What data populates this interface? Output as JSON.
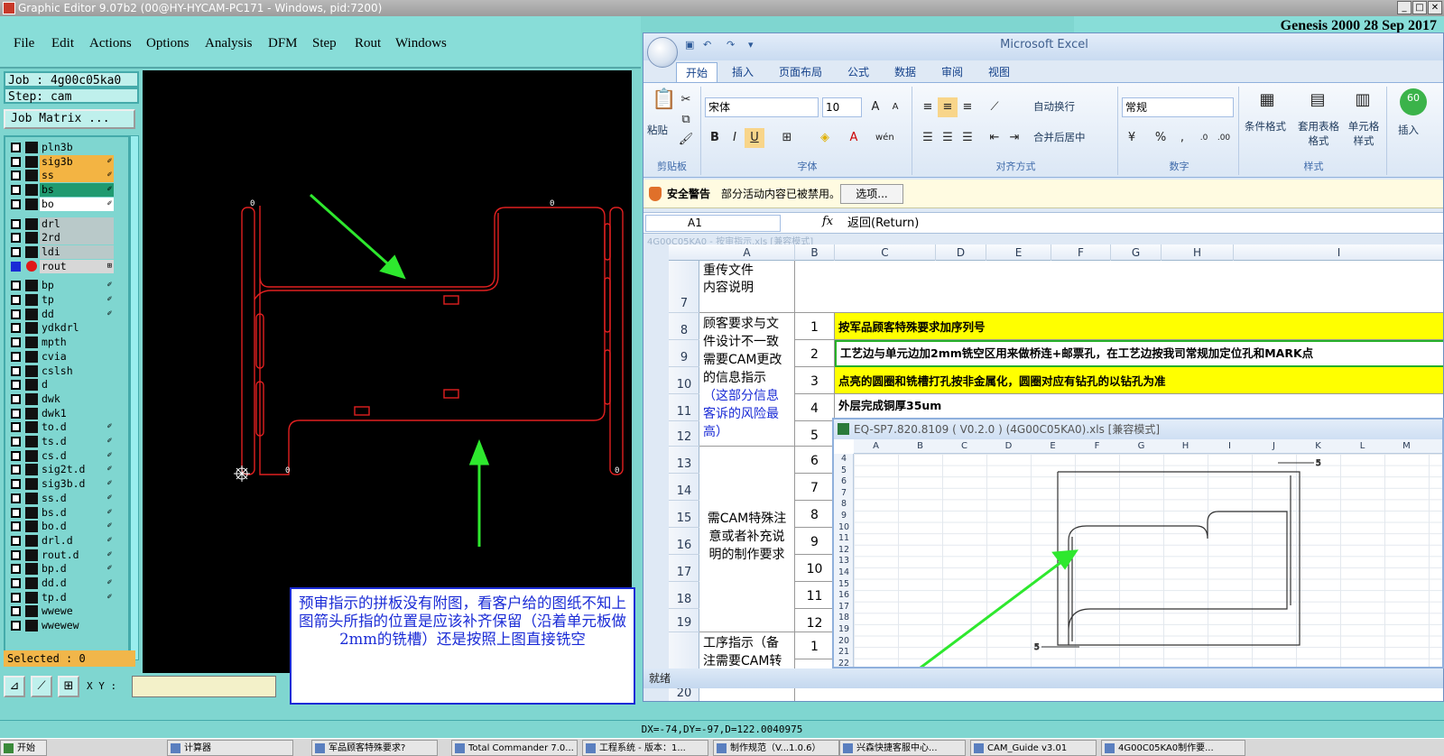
{
  "genesis": {
    "title": "Graphic Editor 9.07b2 (00@HY-HYCAM-PC171 - Windows, pid:7200)",
    "brand": "Genesis 2000 28 Sep 2017",
    "menu": [
      "File",
      "Edit",
      "Actions",
      "Options",
      "Analysis",
      "DFM",
      "Step",
      "Rout",
      "Windows"
    ],
    "job": "Job : 4g00c05ka0",
    "step": "Step: cam",
    "job_matrix": "Job Matrix ...",
    "layers": [
      {
        "name": "pln3b",
        "color": "#7fd6d0"
      },
      {
        "name": "sig3b",
        "color": "#f3b443",
        "mark": "✐"
      },
      {
        "name": "ss",
        "color": "#f3b443",
        "mark": "✐"
      },
      {
        "name": "bs",
        "color": "#1f9a70",
        "mark": "✐"
      },
      {
        "name": "bo",
        "color": "#ffffff",
        "mark": "✐"
      },
      {
        "name": "drl",
        "color": "#b9c9c9"
      },
      {
        "name": "2rd",
        "color": "#b9c9c9"
      },
      {
        "name": "ldi",
        "color": "#b9c9c9"
      },
      {
        "name": "rout",
        "color": "#d7d7d7",
        "mark": "⊞"
      },
      {
        "name": "bp",
        "color": "#7fd6d0",
        "mark": "✐"
      },
      {
        "name": "tp",
        "color": "#7fd6d0",
        "mark": "✐"
      },
      {
        "name": "dd",
        "color": "#7fd6d0",
        "mark": "✐"
      },
      {
        "name": "ydkdrl",
        "color": "#7fd6d0"
      },
      {
        "name": "mpth",
        "color": "#7fd6d0"
      },
      {
        "name": "cvia",
        "color": "#7fd6d0"
      },
      {
        "name": "cslsh",
        "color": "#7fd6d0"
      },
      {
        "name": "d",
        "color": "#7fd6d0"
      },
      {
        "name": "dwk",
        "color": "#7fd6d0"
      },
      {
        "name": "dwk1",
        "color": "#7fd6d0"
      },
      {
        "name": "to.d",
        "color": "#7fd6d0",
        "mark": "✐"
      },
      {
        "name": "ts.d",
        "color": "#7fd6d0",
        "mark": "✐"
      },
      {
        "name": "cs.d",
        "color": "#7fd6d0",
        "mark": "✐"
      },
      {
        "name": "sig2t.d",
        "color": "#7fd6d0",
        "mark": "✐"
      },
      {
        "name": "sig3b.d",
        "color": "#7fd6d0",
        "mark": "✐"
      },
      {
        "name": "ss.d",
        "color": "#7fd6d0",
        "mark": "✐"
      },
      {
        "name": "bs.d",
        "color": "#7fd6d0",
        "mark": "✐"
      },
      {
        "name": "bo.d",
        "color": "#7fd6d0",
        "mark": "✐"
      },
      {
        "name": "drl.d",
        "color": "#7fd6d0",
        "mark": "✐"
      },
      {
        "name": "rout.d",
        "color": "#7fd6d0",
        "mark": "✐"
      },
      {
        "name": "bp.d",
        "color": "#7fd6d0",
        "mark": "✐"
      },
      {
        "name": "dd.d",
        "color": "#7fd6d0",
        "mark": "✐"
      },
      {
        "name": "tp.d",
        "color": "#7fd6d0",
        "mark": "✐"
      },
      {
        "name": "wwewe",
        "color": "#7fd6d0"
      },
      {
        "name": "wwewew",
        "color": "#7fd6d0"
      }
    ],
    "selected": "Selected : 0",
    "xy_label": "X Y :",
    "status": "DX=-74,DY=-97,D=122.0040975",
    "canvas_labels": [
      "0",
      "0",
      "0",
      "0"
    ]
  },
  "note": "预审指示的拼板没有附图，看客户给的图纸不知上图箭头所指的位置是应该补齐保留（沿着单元板做2mm的铣槽）还是按照上图直接铣空",
  "excel": {
    "app_title": "Microsoft Excel",
    "tabs": [
      "开始",
      "插入",
      "页面布局",
      "公式",
      "数据",
      "审阅",
      "视图"
    ],
    "paste": "粘贴",
    "clipboard": "剪贴板",
    "font_name": "宋体",
    "font_size": "10",
    "font_group": "字体",
    "wrap": "自动换行",
    "merge": "合并后居中",
    "align_group": "对齐方式",
    "number_format": "常规",
    "number_group": "数字",
    "cond_format": "条件格式",
    "table_format": "套用表格格式",
    "cell_style": "单元格样式",
    "style_group": "样式",
    "insert": "插入",
    "security_title": "安全警告",
    "security_msg": "部分活动内容已被禁用。",
    "options": "选项...",
    "name_box": "A1",
    "formula": "返回(Return)",
    "ghost_path": "4G00C05KA0 - 按审指示.xls  [兼容模式]",
    "columns": [
      "A",
      "B",
      "C",
      "D",
      "E",
      "F",
      "G",
      "H",
      "I"
    ],
    "rows": [
      "7",
      "8",
      "9",
      "10",
      "11",
      "12",
      "13",
      "14",
      "15",
      "16",
      "17",
      "18",
      "19",
      "20"
    ],
    "a7": "重传文件\n内容说明",
    "a8": "顾客要求与文件设计不一致需要CAM更改的信息指示",
    "a8_note": "（这部分信息客诉的风险最高）",
    "a13": "需CAM特殊注意或者补充说明的制作要求",
    "a20": "工序指示（备注需要CAM转化",
    "items": [
      {
        "n": "1",
        "text": "按军品顾客特殊要求加序列号"
      },
      {
        "n": "2",
        "text": "工艺边与单元边加2mm铣空区用来做桥连+邮票孔，在工艺边按我司常规加定位孔和MARK点"
      },
      {
        "n": "3",
        "text": "点亮的圆圈和铣槽打孔按非金属化，圆圈对应有钻孔的以钻孔为准"
      },
      {
        "n": "4",
        "text": "外层完成铜厚35um"
      },
      {
        "n": "5",
        "text": ""
      }
    ],
    "b_more": [
      "6",
      "7",
      "8",
      "9",
      "10",
      "11",
      "12",
      "1"
    ],
    "status": "就绪"
  },
  "excel2": {
    "title": "EQ-SP7.820.8109 ( V0.2.0 ) (4G00C05KA0).xls  [兼容模式]",
    "columns": [
      "A",
      "B",
      "C",
      "D",
      "E",
      "F",
      "G",
      "H",
      "I",
      "J",
      "K",
      "L",
      "M"
    ],
    "rows": [
      "4",
      "5",
      "6",
      "7",
      "8",
      "9",
      "10",
      "11",
      "12",
      "13",
      "14",
      "15",
      "16",
      "17",
      "18",
      "19",
      "20",
      "21",
      "22"
    ],
    "dim": [
      "5",
      "5"
    ]
  },
  "taskbar": {
    "start": "开始",
    "tasks": [
      "计算器",
      "军品顾客特殊要求?",
      "Total Commander 7.0...",
      "工程系统 - 版本：1...",
      "制作规范（V...1.0.6）",
      "兴森快捷客服中心...",
      "CAM_Guide v3.01",
      "4G00C05KA0制作要..."
    ]
  }
}
